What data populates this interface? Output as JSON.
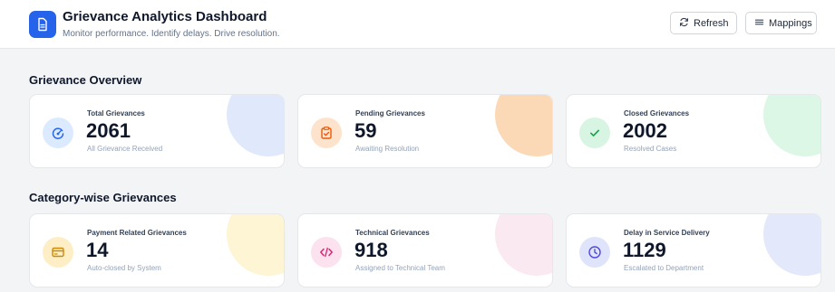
{
  "header": {
    "logo_icon": "document-icon",
    "title": "Grievance Analytics Dashboard",
    "subtitle": "Monitor performance. Identify delays. Drive resolution.",
    "refresh_label": "Refresh",
    "refresh_icon": "refresh-icon",
    "mappings_label": "Mappings",
    "mappings_icon": "menu-lines-icon",
    "accent": "#2563eb"
  },
  "overview": {
    "title": "Grievance Overview",
    "cards": [
      {
        "label": "Total Grievances",
        "value": "2061",
        "sub": "All Grievance Received",
        "icon": "gauge-icon",
        "icon_color": "#2563eb",
        "icon_bg": "#dbeafe",
        "blob": "#e0e9fb"
      },
      {
        "label": "Pending Grievances",
        "value": "59",
        "sub": "Awaiting Resolution",
        "icon": "clipboard-check-icon",
        "icon_color": "#ea580c",
        "icon_bg": "#fde3cc",
        "blob": "#fcd9b6"
      },
      {
        "label": "Closed Grievances",
        "value": "2002",
        "sub": "Resolved Cases",
        "icon": "check-icon",
        "icon_color": "#16a34a",
        "icon_bg": "#d7f5e2",
        "blob": "#dcf7e6"
      }
    ]
  },
  "category": {
    "title": "Category-wise Grievances",
    "cards": [
      {
        "label": "Payment Related Grievances",
        "value": "14",
        "sub": "Auto-closed by System",
        "icon": "credit-card-icon",
        "icon_color": "#ca8a04",
        "icon_bg": "#fdeec5",
        "blob": "#fdf5d3"
      },
      {
        "label": "Technical Grievances",
        "value": "918",
        "sub": "Assigned to Technical Team",
        "icon": "code-icon",
        "icon_color": "#db2777",
        "icon_bg": "#fce1ee",
        "blob": "#fbe9f2"
      },
      {
        "label": "Delay in Service Delivery",
        "value": "1129",
        "sub": "Escalated to Department",
        "icon": "clock-icon",
        "icon_color": "#4f46e5",
        "icon_bg": "#e0e4fb",
        "blob": "#e3e8fb"
      }
    ]
  }
}
